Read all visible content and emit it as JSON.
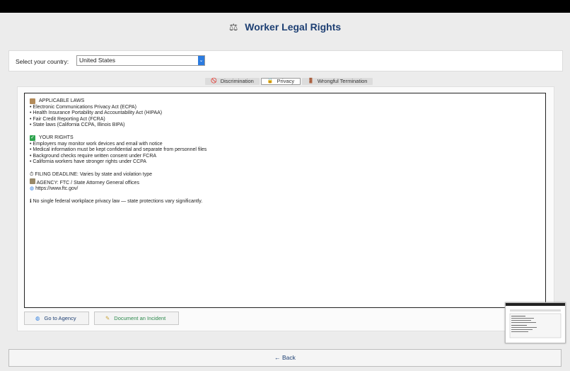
{
  "app": {
    "title": "Worker Legal Rights",
    "title_icon": "⚖"
  },
  "country": {
    "label": "Select your country:",
    "selected": "United States"
  },
  "tabs": [
    {
      "label": "Discrimination",
      "icon": "🚫",
      "active": false
    },
    {
      "label": "Privacy",
      "icon": "🔒",
      "active": true
    },
    {
      "label": "Wrongful Termination",
      "icon": "🚪",
      "active": false
    }
  ],
  "content": {
    "laws_title": "APPLICABLE LAWS",
    "laws": [
      "• Electronic Communications Privacy Act (ECPA)",
      "• Health Insurance Portability and Accountability Act (HIPAA)",
      "• Fair Credit Reporting Act (FCRA)",
      "• State laws (California CCPA, Illinois BIPA)"
    ],
    "rights_title": "YOUR RIGHTS",
    "rights": [
      "• Employers may monitor work devices and email with notice",
      "• Medical information must be kept confidential and separate from personnel files",
      "• Background checks require written consent under FCRA",
      "• California workers have stronger rights under CCPA"
    ],
    "filing": "FILING DEADLINE:  Varies by state and violation type",
    "agency": "AGENCY:  FTC / State Attorney General offices",
    "url": "https://www.ftc.gov/",
    "note": "No single federal workplace privacy law — state protections vary significantly."
  },
  "buttons": {
    "agency": "Go to Agency",
    "document": "Document an Incident",
    "back": "← Back"
  },
  "icons": {
    "laws": "law-book-icon",
    "rights": "checkmark-icon",
    "filing": "clock-icon",
    "agency": "building-icon",
    "url": "globe-icon",
    "note": "info-icon",
    "agency_button": "globe-icon",
    "document_button": "pencil-icon"
  },
  "colors": {
    "title": "#1d3f73",
    "select_arrow": "#2b7be0",
    "rights_check": "#2ea44f",
    "document_button": "#2d8a4d"
  }
}
